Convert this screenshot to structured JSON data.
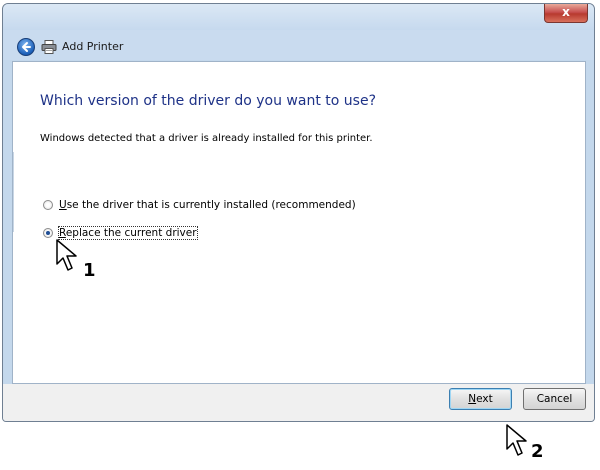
{
  "window": {
    "close_glyph": "x",
    "title": "Add Printer"
  },
  "page": {
    "heading": "Which version of the driver do you want to use?",
    "subtext": "Windows detected that a driver is already installed for this printer."
  },
  "options": [
    {
      "accesskey": "U",
      "label_rest": "se the driver that is currently installed (recommended)",
      "checked": false
    },
    {
      "accesskey": "R",
      "label_rest": "eplace the current driver",
      "checked": true
    }
  ],
  "buttons": {
    "next_accesskey": "N",
    "next_rest": "ext",
    "cancel_label": "Cancel"
  },
  "annotations": {
    "step1": "1",
    "step2": "2"
  },
  "icons": {
    "back": "back-arrow-icon",
    "printer": "printer-icon",
    "cursor": "mouse-pointer-icon"
  },
  "colors": {
    "heading": "#1e3287",
    "frame": "#c4d8ec",
    "close_button": "#c75050"
  }
}
